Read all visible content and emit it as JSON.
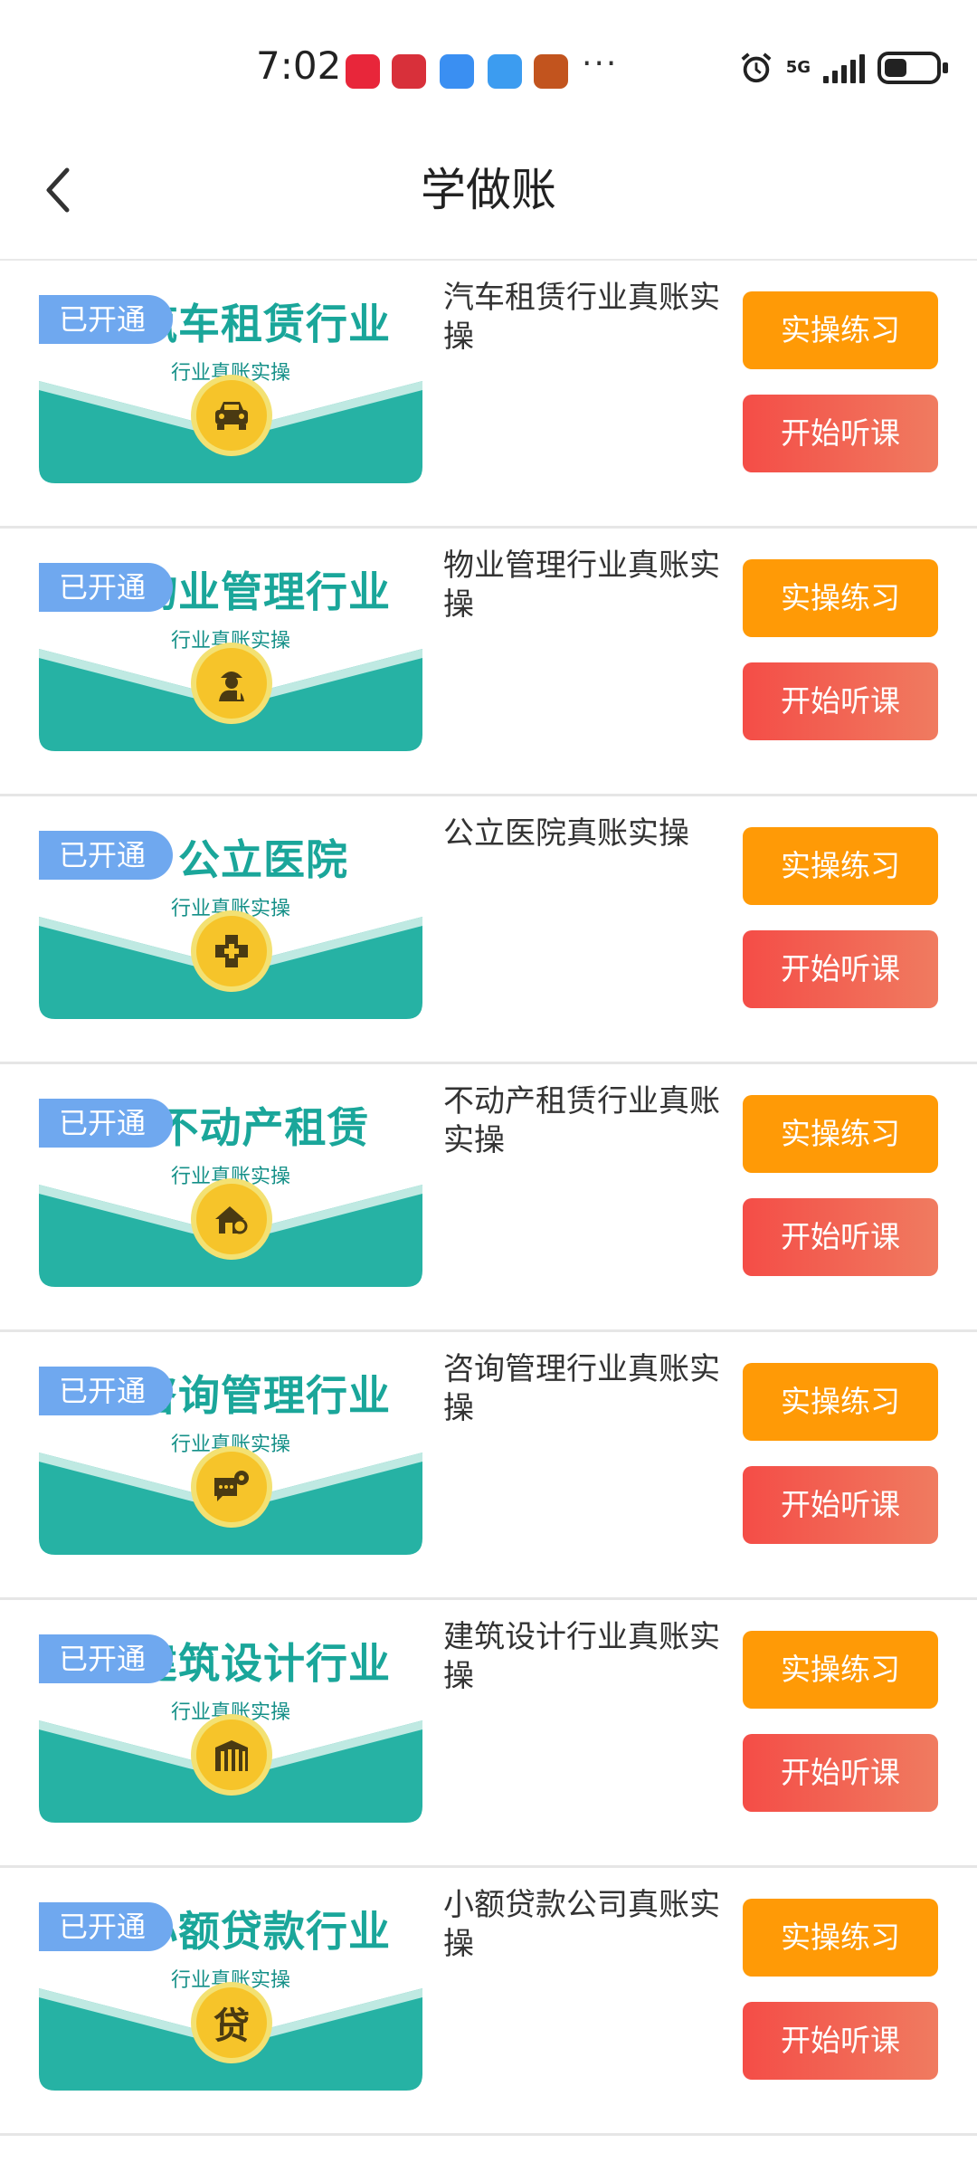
{
  "status_bar": {
    "time": "7:02",
    "apps": [
      {
        "icon": "xiaohongshu-app-icon",
        "color": "#e8263a"
      },
      {
        "icon": "huawei-app-icon",
        "color": "#d8303a"
      },
      {
        "icon": "cloud-app-icon",
        "color": "#3a8ff2"
      },
      {
        "icon": "weather-app-icon",
        "color": "#3c9cf0"
      },
      {
        "icon": "game-app-icon",
        "color": "#c2541e"
      }
    ],
    "more": "···",
    "network": "5G"
  },
  "header": {
    "title": "学做账",
    "back_icon": "chevron-left-icon"
  },
  "colors": {
    "practice_button": "#ff9a06",
    "listen_button": "#f44d47",
    "banner_teal": "#26b2a4",
    "badge_blue": "#6fa8ef"
  },
  "courses": [
    {
      "banner_title": "汽车租赁行业",
      "banner_subtitle": "行业真账实操",
      "icon": "car-icon",
      "badge": "已开通",
      "name": "汽车租赁行业真账实操",
      "practice_label": "实操练习",
      "listen_label": "开始听课"
    },
    {
      "banner_title": "物业管理行业",
      "banner_subtitle": "行业真账实操",
      "icon": "worker-icon",
      "badge": "已开通",
      "name": "物业管理行业真账实操",
      "practice_label": "实操练习",
      "listen_label": "开始听课"
    },
    {
      "banner_title": "公立医院",
      "banner_subtitle": "行业真账实操",
      "icon": "medical-cross-icon",
      "badge": "已开通",
      "name": "公立医院真账实操",
      "practice_label": "实操练习",
      "listen_label": "开始听课"
    },
    {
      "banner_title": "不动产租赁",
      "banner_subtitle": "行业真账实操",
      "icon": "house-key-icon",
      "badge": "已开通",
      "name": "不动产租赁行业真账实操",
      "practice_label": "实操练习",
      "listen_label": "开始听课"
    },
    {
      "banner_title": "咨询管理行业",
      "banner_subtitle": "行业真账实操",
      "icon": "chat-gear-icon",
      "badge": "已开通",
      "name": "咨询管理行业真账实操",
      "practice_label": "实操练习",
      "listen_label": "开始听课"
    },
    {
      "banner_title": "建筑设计行业",
      "banner_subtitle": "行业真账实操",
      "icon": "building-icon",
      "badge": "已开通",
      "name": "建筑设计行业真账实操",
      "practice_label": "实操练习",
      "listen_label": "开始听课"
    },
    {
      "banner_title": "小额贷款行业",
      "banner_subtitle": "行业真账实操",
      "icon": "loan-icon",
      "icon_text": "贷",
      "badge": "已开通",
      "name": "小额贷款公司真账实操",
      "practice_label": "实操练习",
      "listen_label": "开始听课"
    }
  ]
}
